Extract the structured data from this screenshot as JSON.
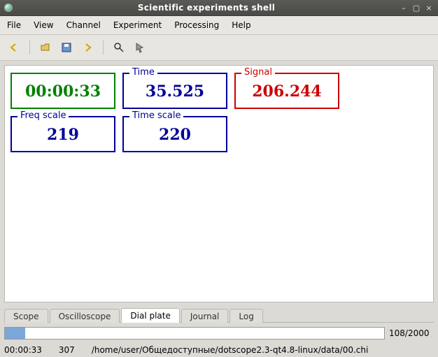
{
  "window": {
    "title": "Scientific experiments shell"
  },
  "menu": {
    "file": "File",
    "view": "View",
    "channel": "Channel",
    "experiment": "Experiment",
    "processing": "Processing",
    "help": "Help"
  },
  "dials": {
    "elapsed": "00:00:33",
    "time_label": "Time",
    "time_value": "35.525",
    "signal_label": "Signal",
    "signal_value": "206.244",
    "freq_label": "Freq scale",
    "freq_value": "219",
    "tscale_label": "Time scale",
    "tscale_value": "220"
  },
  "tabs": {
    "scope": "Scope",
    "oscilloscope": "Oscilloscope",
    "dial_plate": "Dial plate",
    "journal": "Journal",
    "log": "Log"
  },
  "progress": {
    "label": "108/2000"
  },
  "status": {
    "time": "00:00:33",
    "count": "307",
    "path": "/home/user/Общедоступные/dotscope2.3-qt4.8-linux/data/00.chi"
  }
}
